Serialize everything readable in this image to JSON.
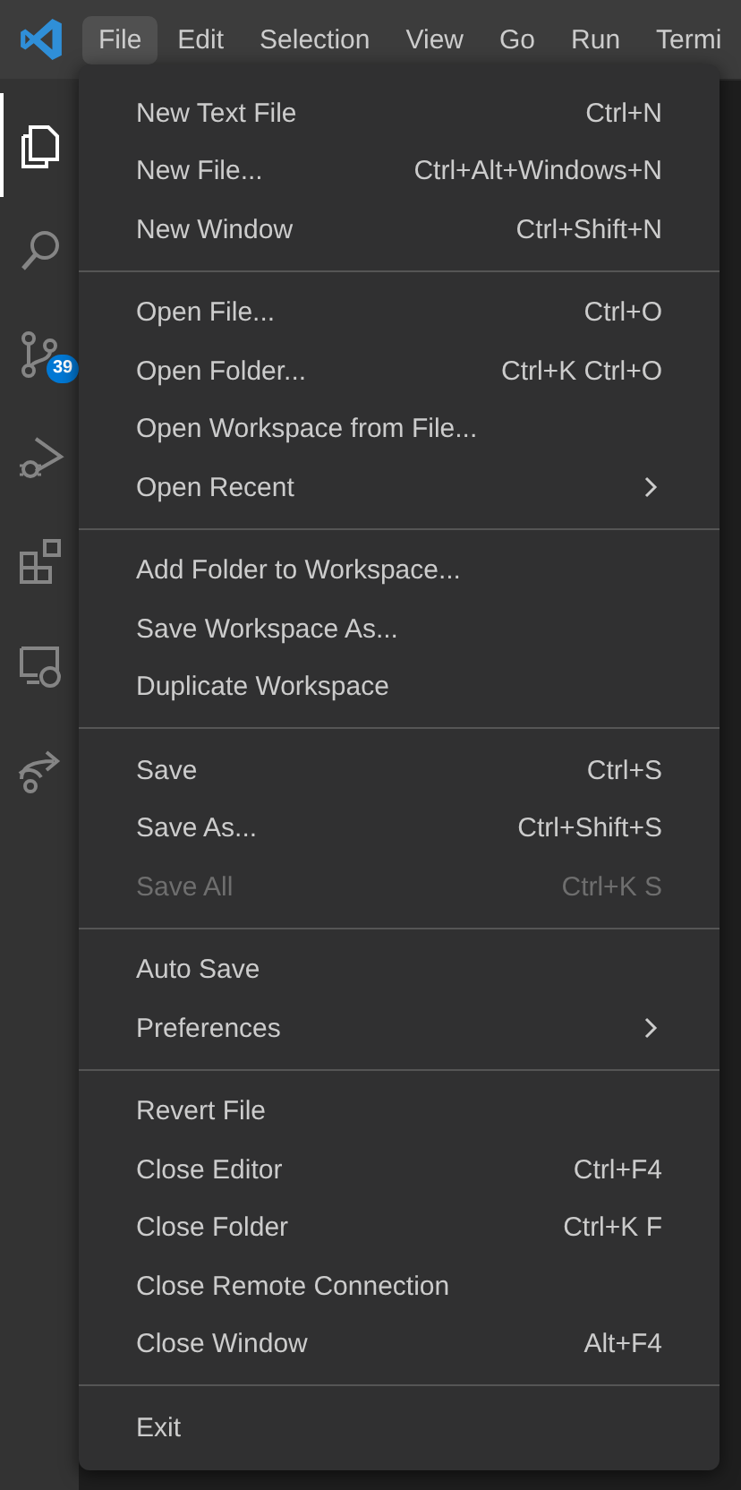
{
  "menubar": {
    "items": [
      {
        "label": "File",
        "selected": true
      },
      {
        "label": "Edit",
        "selected": false
      },
      {
        "label": "Selection",
        "selected": false
      },
      {
        "label": "View",
        "selected": false
      },
      {
        "label": "Go",
        "selected": false
      },
      {
        "label": "Run",
        "selected": false
      },
      {
        "label": "Termi",
        "selected": false
      }
    ]
  },
  "activity_bar": {
    "items": [
      {
        "kind": "explorer",
        "selected": true
      },
      {
        "kind": "search",
        "selected": false
      },
      {
        "kind": "source-control",
        "selected": false,
        "badge": "39"
      },
      {
        "kind": "run-debug",
        "selected": false
      },
      {
        "kind": "extensions",
        "selected": false
      },
      {
        "kind": "remote",
        "selected": false
      },
      {
        "kind": "share",
        "selected": false
      }
    ]
  },
  "file_menu": {
    "items": [
      {
        "kind": "item",
        "label": "New Text File",
        "shortcut": "Ctrl+N",
        "disabled": false,
        "submenu": false
      },
      {
        "kind": "item",
        "label": "New File...",
        "shortcut": "Ctrl+Alt+Windows+N",
        "disabled": false,
        "submenu": false
      },
      {
        "kind": "item",
        "label": "New Window",
        "shortcut": "Ctrl+Shift+N",
        "disabled": false,
        "submenu": false
      },
      {
        "kind": "separator"
      },
      {
        "kind": "item",
        "label": "Open File...",
        "shortcut": "Ctrl+O",
        "disabled": false,
        "submenu": false
      },
      {
        "kind": "item",
        "label": "Open Folder...",
        "shortcut": "Ctrl+K Ctrl+O",
        "disabled": false,
        "submenu": false
      },
      {
        "kind": "item",
        "label": "Open Workspace from File...",
        "disabled": false,
        "submenu": false
      },
      {
        "kind": "item",
        "label": "Open Recent",
        "disabled": false,
        "submenu": true
      },
      {
        "kind": "separator"
      },
      {
        "kind": "item",
        "label": "Add Folder to Workspace...",
        "disabled": false,
        "submenu": false
      },
      {
        "kind": "item",
        "label": "Save Workspace As...",
        "disabled": false,
        "submenu": false
      },
      {
        "kind": "item",
        "label": "Duplicate Workspace",
        "disabled": false,
        "submenu": false
      },
      {
        "kind": "separator"
      },
      {
        "kind": "item",
        "label": "Save",
        "shortcut": "Ctrl+S",
        "disabled": false,
        "submenu": false
      },
      {
        "kind": "item",
        "label": "Save As...",
        "shortcut": "Ctrl+Shift+S",
        "disabled": false,
        "submenu": false
      },
      {
        "kind": "item",
        "label": "Save All",
        "shortcut": "Ctrl+K S",
        "disabled": true,
        "submenu": false
      },
      {
        "kind": "separator"
      },
      {
        "kind": "item",
        "label": "Auto Save",
        "disabled": false,
        "submenu": false
      },
      {
        "kind": "item",
        "label": "Preferences",
        "disabled": false,
        "submenu": true
      },
      {
        "kind": "separator"
      },
      {
        "kind": "item",
        "label": "Revert File",
        "disabled": false,
        "submenu": false
      },
      {
        "kind": "item",
        "label": "Close Editor",
        "shortcut": "Ctrl+F4",
        "disabled": false,
        "submenu": false
      },
      {
        "kind": "item",
        "label": "Close Folder",
        "shortcut": "Ctrl+K F",
        "disabled": false,
        "submenu": false
      },
      {
        "kind": "item",
        "label": "Close Remote Connection",
        "disabled": false,
        "submenu": false
      },
      {
        "kind": "item",
        "label": "Close Window",
        "shortcut": "Alt+F4",
        "disabled": false,
        "submenu": false
      },
      {
        "kind": "separator"
      },
      {
        "kind": "item",
        "label": "Exit",
        "disabled": false,
        "submenu": false
      }
    ]
  }
}
